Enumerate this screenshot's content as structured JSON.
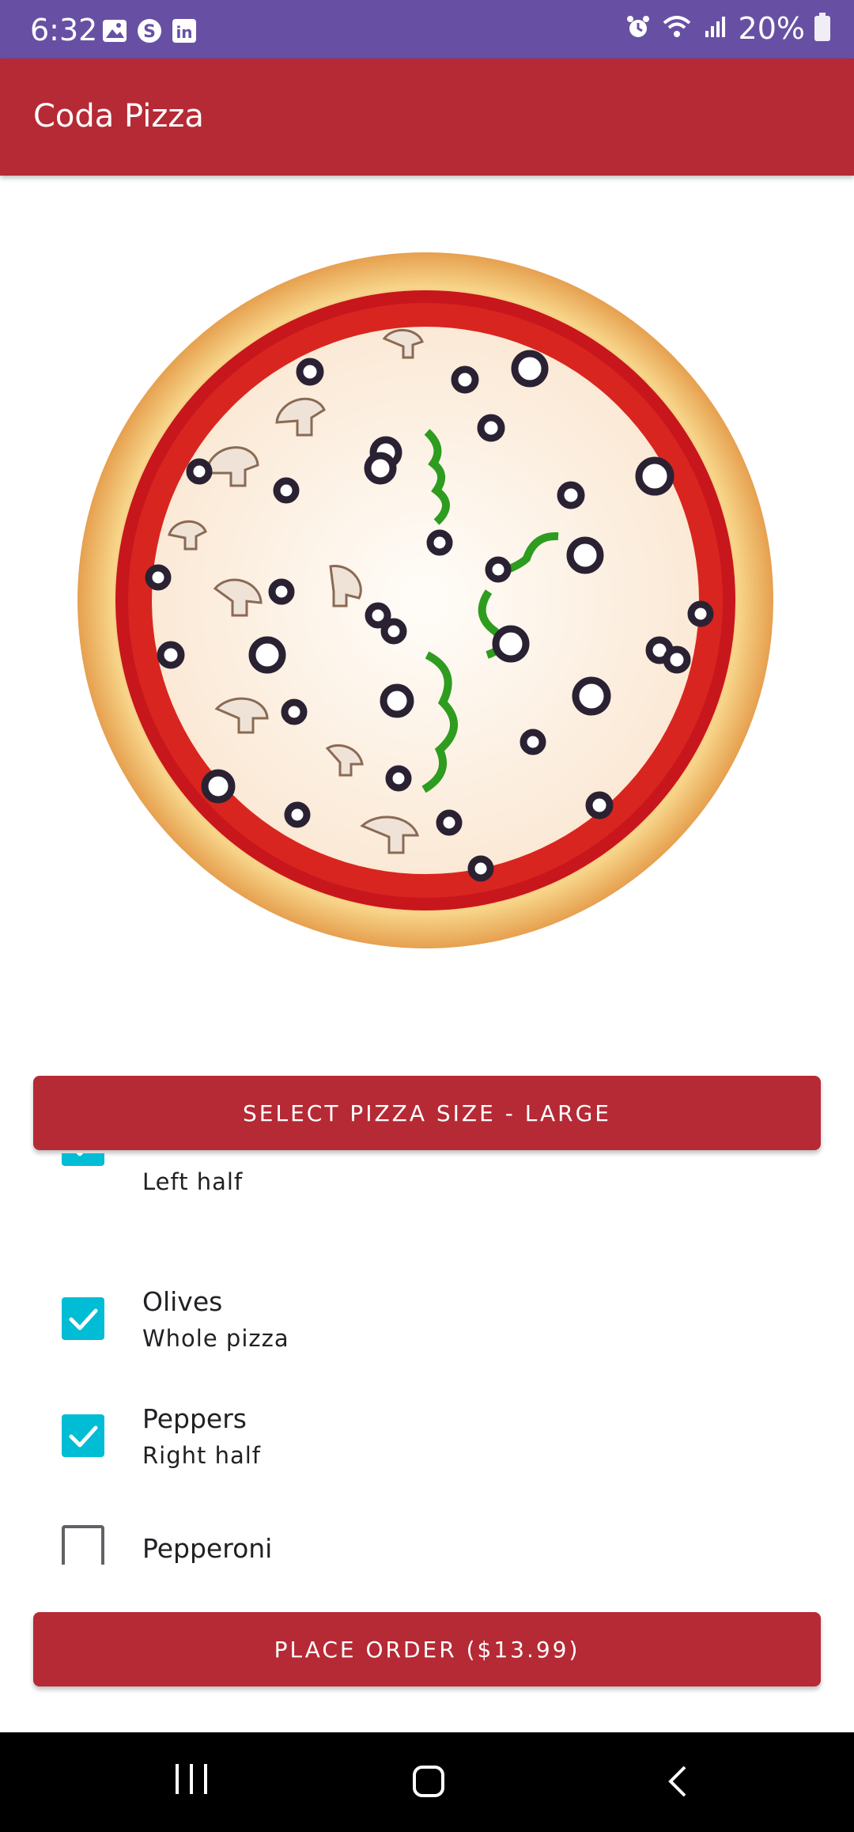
{
  "status_bar": {
    "time": "6:32",
    "battery": "20%",
    "icons_left": [
      "gallery-icon",
      "skype-icon",
      "linkedin-icon"
    ],
    "icons_right": [
      "alarm-icon",
      "wifi-icon",
      "signal-icon",
      "battery-icon"
    ],
    "color": "#6750a4"
  },
  "app_bar": {
    "title": "Coda Pizza",
    "color": "#b52a35"
  },
  "size_button": {
    "label": "SELECT PIZZA SIZE - LARGE"
  },
  "toppings": [
    {
      "name": "",
      "placement": "Left half",
      "checked": true
    },
    {
      "name": "Olives",
      "placement": "Whole pizza",
      "checked": true
    },
    {
      "name": "Peppers",
      "placement": "Right half",
      "checked": true
    },
    {
      "name": "Pepperoni",
      "placement": "",
      "checked": false
    }
  ],
  "order_button": {
    "label": "PLACE ORDER ($13.99)"
  },
  "accent_colors": {
    "checkbox": "#00bcd4",
    "primary": "#b52a35"
  },
  "nav_bar": {
    "icons": [
      "recent-apps-icon",
      "home-icon",
      "back-icon"
    ]
  }
}
